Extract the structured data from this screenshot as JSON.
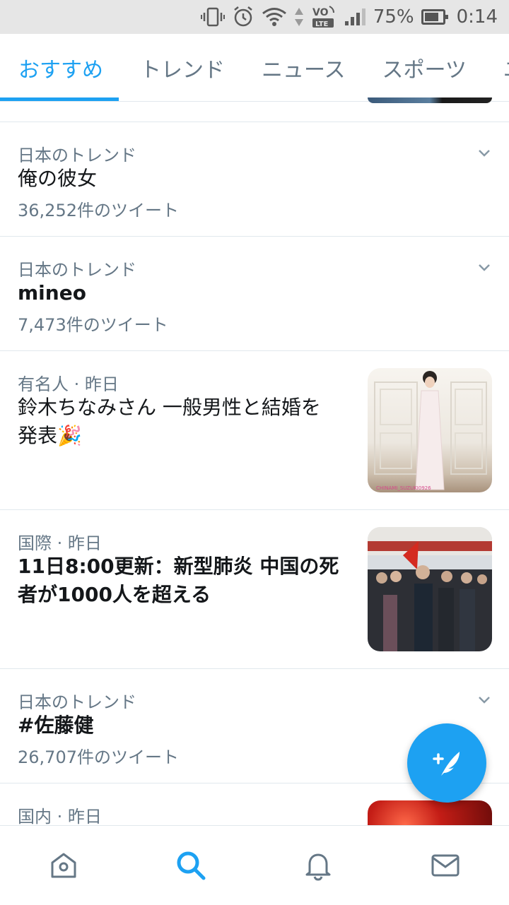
{
  "status_bar": {
    "battery_percent": "75%",
    "time": "0:14",
    "network_label": "VO LTE",
    "icons": [
      "vibrate-icon",
      "alarm-icon",
      "wifi-icon",
      "data-arrows-icon",
      "volte-icon",
      "signal-icon",
      "battery-icon"
    ]
  },
  "tabs": [
    {
      "label": "おすすめ",
      "active": true
    },
    {
      "label": "トレンド",
      "active": false
    },
    {
      "label": "ニュース",
      "active": false
    },
    {
      "label": "スポーツ",
      "active": false
    },
    {
      "label": "ユ",
      "active": false
    }
  ],
  "feed": [
    {
      "type": "trend",
      "meta": "日本のトレンド",
      "title": "俺の彼女",
      "count": "36,252件のツイート"
    },
    {
      "type": "trend",
      "meta": "日本のトレンド",
      "title": "mineo",
      "count": "7,473件のツイート"
    },
    {
      "type": "news",
      "meta": "有名人 · 昨日",
      "title_line1": "鈴木ちなみさん 一般男性と結婚を",
      "title_line2": "発表🎉",
      "thumbnail_caption": "CHINAMI_SUZUKI0926"
    },
    {
      "type": "news",
      "meta": "国際 · 昨日",
      "title_line1": "11日8:00更新：新型肺炎 中国の死",
      "title_line2": "者が1000人を超える"
    },
    {
      "type": "trend",
      "meta": "日本のトレンド",
      "title": "#佐藤健",
      "count": "26,707件のツイート"
    },
    {
      "type": "news",
      "meta": "国内 · 昨日"
    }
  ],
  "fab": {
    "icon": "compose-tweet-icon",
    "color": "#1da1f2"
  },
  "bottom_nav": [
    {
      "name": "home",
      "icon": "home-icon",
      "active": false
    },
    {
      "name": "search",
      "icon": "search-icon",
      "active": true
    },
    {
      "name": "notifications",
      "icon": "bell-icon",
      "active": false
    },
    {
      "name": "messages",
      "icon": "mail-icon",
      "active": false
    }
  ],
  "colors": {
    "accent": "#1da1f2",
    "secondary_text": "#657786",
    "divider": "#e1e8ed"
  }
}
